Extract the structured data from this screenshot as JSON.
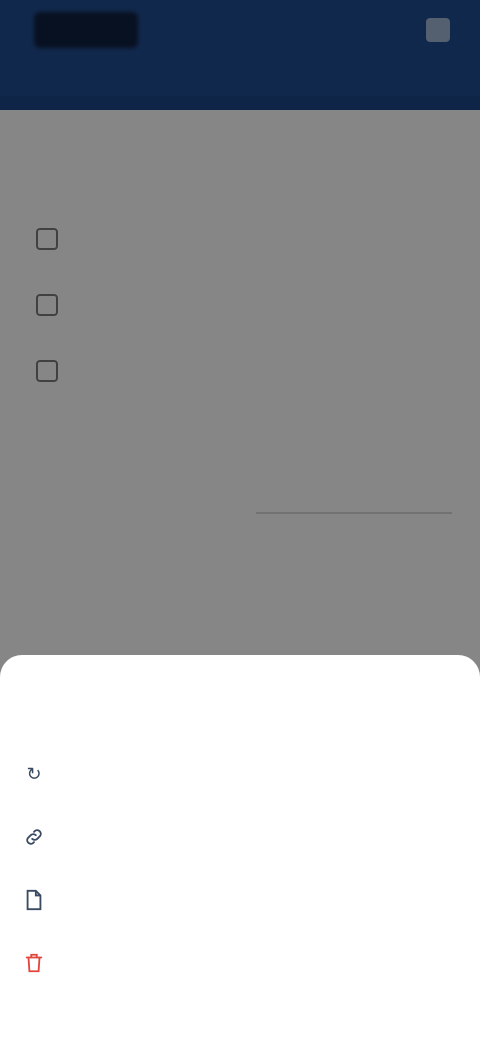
{
  "header": {
    "title": "",
    "action_label": ""
  },
  "content": {
    "heading": "",
    "items": [
      {
        "line1": "",
        "line2": ""
      },
      {
        "line1": "",
        "line2": ""
      },
      {
        "line1": "",
        "line2": ""
      }
    ]
  },
  "sheet": {
    "title": "",
    "items": [
      {
        "label": "",
        "icon": "refresh-icon"
      },
      {
        "label": "",
        "icon": "link-icon"
      },
      {
        "label": "",
        "icon": "document-icon"
      },
      {
        "label": "",
        "icon": "delete-icon"
      }
    ]
  },
  "colors": {
    "header": "#204a8c",
    "danger": "#e0463c",
    "sheet_title": "#2d4a6f"
  }
}
